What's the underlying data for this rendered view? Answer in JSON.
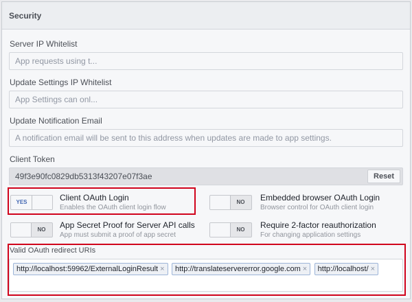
{
  "header": {
    "title": "Security"
  },
  "server_ip_whitelist": {
    "label": "Server IP Whitelist",
    "placeholder": "App requests using t..."
  },
  "update_settings_ip_whitelist": {
    "label": "Update Settings IP Whitelist",
    "placeholder": "App Settings can onl..."
  },
  "update_notification_email": {
    "label": "Update Notification Email",
    "placeholder": "A notification email will be sent to this address when updates are made to app settings."
  },
  "client_token": {
    "label": "Client Token",
    "value": "49f3e90fc0829db5313f43207e07f3ae",
    "reset_label": "Reset"
  },
  "options": {
    "client_oauth_login": {
      "state": "YES",
      "title": "Client OAuth Login",
      "description": "Enables the OAuth client login flow"
    },
    "embedded_browser_oauth_login": {
      "state": "NO",
      "title": "Embedded browser OAuth Login",
      "description": "Browser control for OAuth client login"
    },
    "app_secret_proof": {
      "state": "NO",
      "title": "App Secret Proof for Server API calls",
      "description": "App must submit a proof of app secret"
    },
    "require_2fa": {
      "state": "NO",
      "title": "Require 2-factor reauthorization",
      "description": "For changing application settings"
    }
  },
  "redirect_uris": {
    "label": "Valid OAuth redirect URIs",
    "tags": [
      "http://localhost:59962/ExternalLoginResult",
      "http://translateservererror.google.com",
      "http://localhost/"
    ],
    "remove_glyph": "×"
  },
  "colors": {
    "highlight": "#d0021b",
    "toggle_on_text": "#4267b2"
  }
}
